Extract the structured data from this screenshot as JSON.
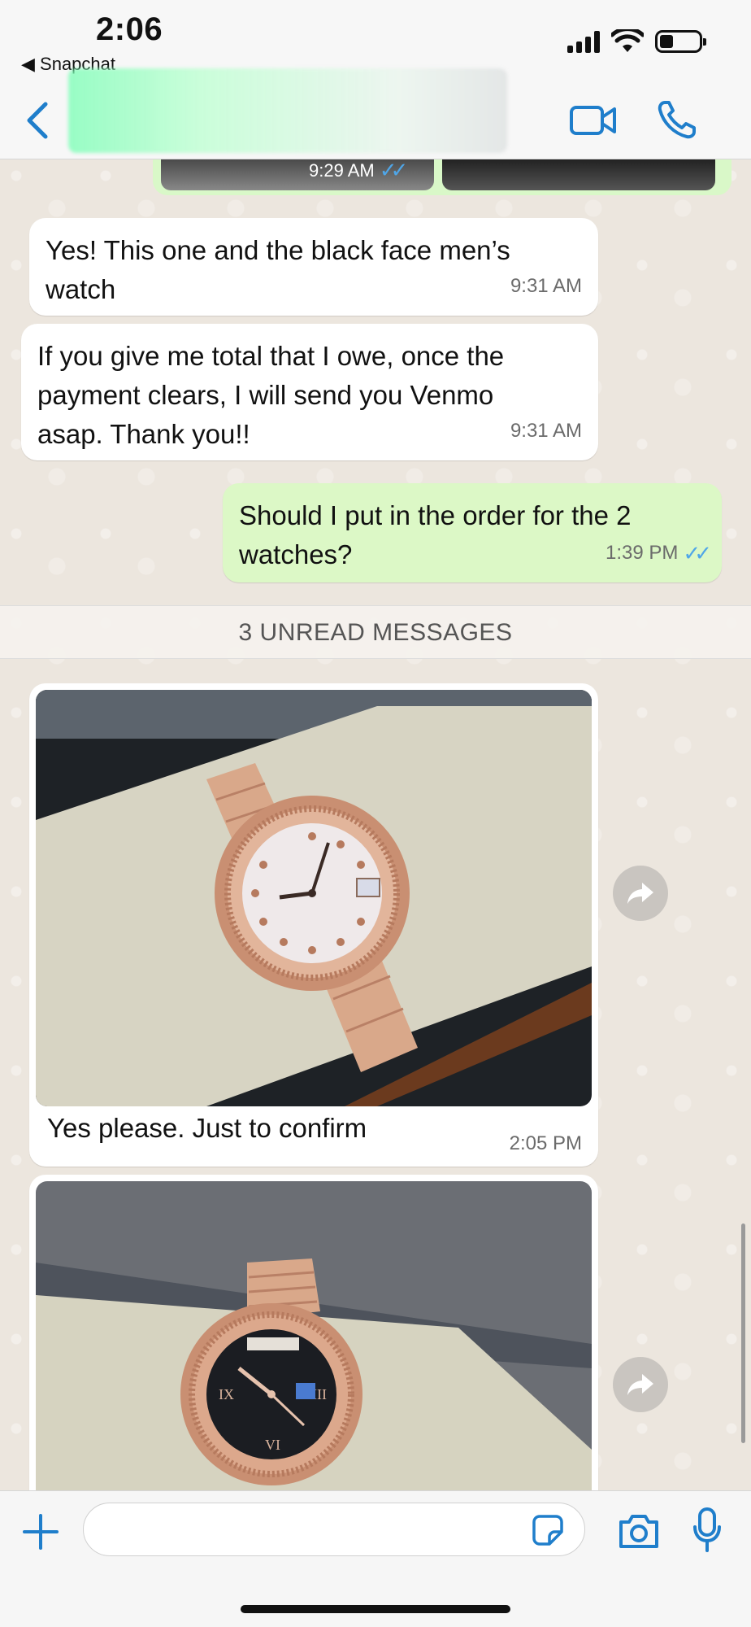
{
  "status_bar": {
    "time": "2:06",
    "back_app": "◀ Snapchat",
    "battery_fraction": 0.35
  },
  "header": {
    "back_icon": "chevron-left-icon",
    "video_icon": "video-camera-icon",
    "call_icon": "phone-icon"
  },
  "messages": [
    {
      "direction": "out",
      "type": "media",
      "time": "9:29 AM",
      "status": "read"
    },
    {
      "direction": "in",
      "text_line1": "Yes! This one and the black face men’s",
      "text_line2": "watch",
      "time": "9:31 AM"
    },
    {
      "direction": "in",
      "text_line1": "If you give me total that I owe, once the",
      "text_line2": "payment clears, I will send you Venmo",
      "text_line3": "asap. Thank you!!",
      "time": "9:31 AM"
    },
    {
      "direction": "out",
      "text_line1": "Should I put in the order for the 2",
      "text_line2": "watches?",
      "time": "1:39 PM",
      "status": "read"
    },
    {
      "direction": "in",
      "type": "media",
      "caption": "Yes please.  Just to confirm",
      "time": "2:05 PM"
    },
    {
      "direction": "in",
      "type": "media"
    }
  ],
  "unread_divider": "3 UNREAD MESSAGES",
  "input": {
    "value": "",
    "placeholder": ""
  },
  "colors": {
    "incoming_bubble": "#ffffff",
    "outgoing_bubble": "#dcf8c6",
    "accent": "#1f7ecb",
    "read_ticks": "#4fa6e8"
  }
}
